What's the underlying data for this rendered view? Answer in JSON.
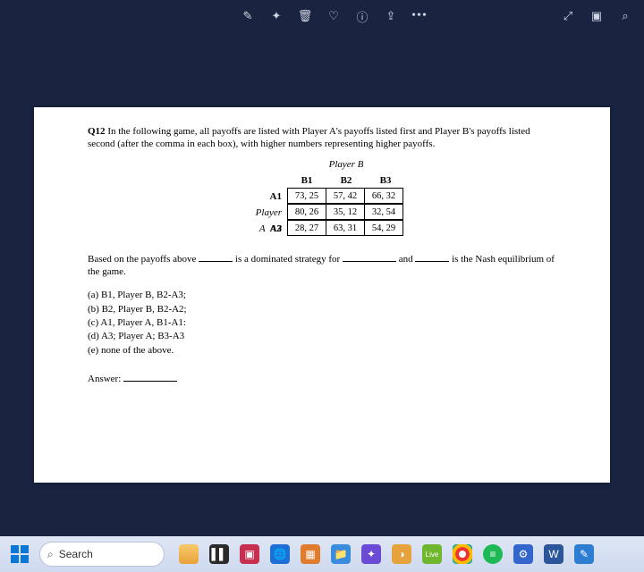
{
  "top": {
    "icon_annotate": "✎",
    "icon_sparkle": "✦",
    "icon_trash": "🗑",
    "icon_heart": "♡",
    "icon_info": "ⓘ",
    "icon_share": "⇪",
    "icon_more": "•••",
    "icon_expand": "⤢",
    "icon_slideshow": "▣",
    "icon_zoom": "⌕"
  },
  "question": {
    "label": "Q12",
    "prompt": " In the following game, all payoffs are listed with Player A's payoffs listed first and Player B's payoffs listed second (after the comma in each box), with higher numbers representing higher payoffs.",
    "player_b": "Player B",
    "player_a": "Player A",
    "cols": {
      "b1": "B1",
      "b2": "B2",
      "b3": "B3"
    },
    "rows": {
      "a1": "A1",
      "a2": "A2",
      "a3": "A3"
    },
    "cells": {
      "a1b1": "73, 25",
      "a1b2": "57, 42",
      "a1b3": "66, 32",
      "a2b1": "80, 26",
      "a2b2": "35, 12",
      "a2b3": "32, 54",
      "a3b1": "28, 27",
      "a3b2": "63, 31",
      "a3b3": "54, 29"
    },
    "fill_parts": {
      "p1": "Based on the payoffs above ",
      "p2": " is a dominated strategy for ",
      "p3": " and ",
      "p4": " is the Nash equilibrium of the game."
    },
    "options": {
      "a": "(a) B1, Player B, B2-A3;",
      "b": "(b) B2, Player B, B2-A2;",
      "c": "(c) A1, Player A, B1-A1:",
      "d": "(d) A3; Player A; B3-A3",
      "e": "(e) none of the above."
    },
    "answer_label": "Answer: "
  },
  "taskbar": {
    "search_placeholder": "Search",
    "live": "Live"
  }
}
